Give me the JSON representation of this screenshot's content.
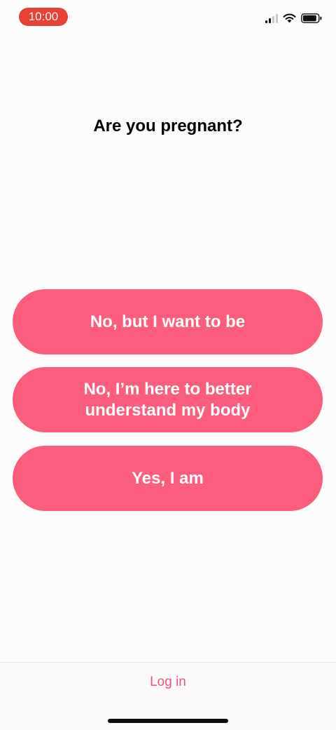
{
  "status_bar": {
    "time": "10:00",
    "icons": [
      "cellular-signal-icon",
      "wifi-icon",
      "battery-icon"
    ]
  },
  "question": {
    "title": "Are you pregnant?"
  },
  "options": [
    {
      "label": "No, but I want to be"
    },
    {
      "label": "No, I’m here to better understand my body"
    },
    {
      "label": "Yes, I am"
    }
  ],
  "footer": {
    "login_label": "Log in"
  },
  "colors": {
    "accent": "#fd5d7c",
    "link": "#e85478",
    "time_pill": "#ea3f35",
    "background": "#fdfcfd"
  }
}
